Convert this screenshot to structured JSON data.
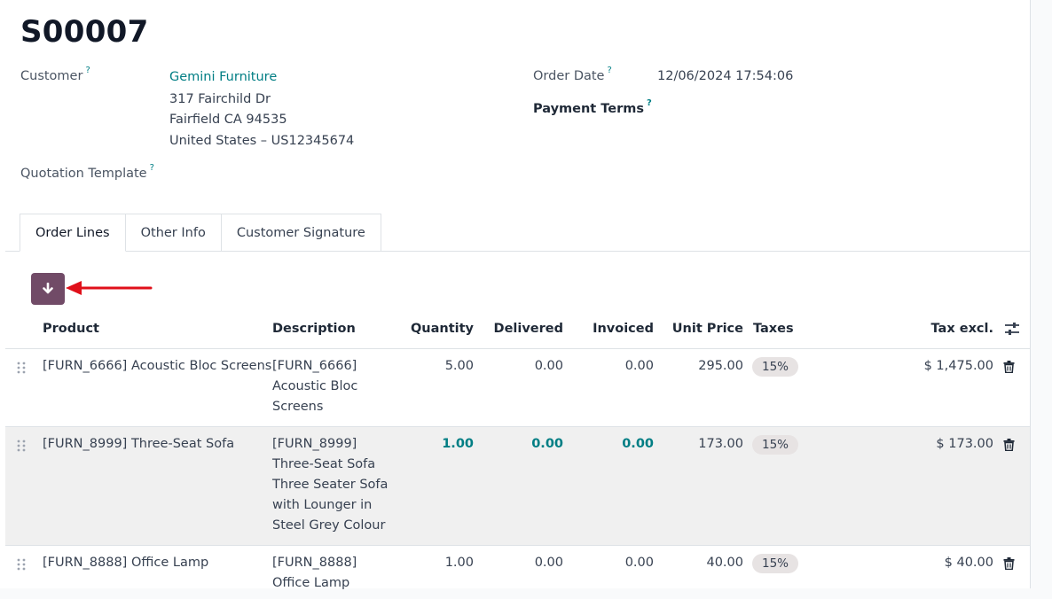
{
  "order": {
    "title": "S00007",
    "customer_label": "Customer",
    "customer_name": "Gemini Furniture",
    "address_line1": "317 Fairchild Dr",
    "address_line2": "Fairfield CA 94535",
    "address_line3": "United States – US12345674",
    "quotation_template_label": "Quotation Template",
    "order_date_label": "Order Date",
    "order_date": "12/06/2024 17:54:06",
    "payment_terms_label": "Payment Terms",
    "help_mark": "?"
  },
  "tabs": [
    {
      "label": "Order Lines",
      "active": true
    },
    {
      "label": "Other Info",
      "active": false
    },
    {
      "label": "Customer Signature",
      "active": false
    }
  ],
  "table": {
    "headers": {
      "product": "Product",
      "description": "Description",
      "quantity": "Quantity",
      "delivered": "Delivered",
      "invoiced": "Invoiced",
      "unit_price": "Unit Price",
      "taxes": "Taxes",
      "tax_excl": "Tax excl."
    },
    "rows": [
      {
        "product": "[FURN_6666] Acoustic Bloc Screens",
        "description": [
          "[FURN_6666]",
          "Acoustic Bloc",
          "Screens"
        ],
        "quantity": "5.00",
        "delivered": "0.00",
        "invoiced": "0.00",
        "unit_price": "295.00",
        "tax": "15%",
        "subtotal": "$ 1,475.00"
      },
      {
        "product": "[FURN_8999] Three-Seat Sofa",
        "description": [
          "[FURN_8999]",
          "Three-Seat Sofa",
          "Three Seater Sofa",
          "with Lounger in",
          "Steel Grey Colour"
        ],
        "quantity": "1.00",
        "delivered": "0.00",
        "invoiced": "0.00",
        "unit_price": "173.00",
        "tax": "15%",
        "subtotal": "$ 173.00"
      },
      {
        "product": "[FURN_8888] Office Lamp",
        "description": [
          "[FURN_8888]",
          "Office Lamp"
        ],
        "quantity": "1.00",
        "delivered": "0.00",
        "invoiced": "0.00",
        "unit_price": "40.00",
        "tax": "15%",
        "subtotal": "$ 40.00"
      }
    ]
  },
  "colors": {
    "primary": "#714b67",
    "link": "#017e84",
    "annotation": "#e0101a",
    "row_highlight": "#f0f0f0"
  },
  "icons": {
    "download_button": "arrow-down-icon",
    "annotation": "red-arrow-icon",
    "row_handle": "drag-handle-icon",
    "row_delete": "trash-icon",
    "columns": "sliders-icon"
  }
}
